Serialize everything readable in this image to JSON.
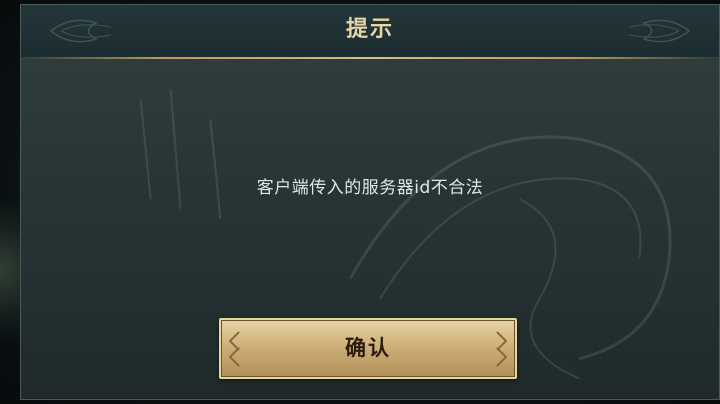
{
  "dialog": {
    "title": "提示",
    "message": "客户端传入的服务器id不合法",
    "confirm_label": "确认"
  },
  "icons": {
    "header_ornament": "leaf-ornament-icon",
    "button_chevron": "chevron-ornament-icon"
  },
  "colors": {
    "title_text": "#e6d5a6",
    "message_text": "#dfe6e4",
    "panel_bg": "#2a3736",
    "gold_accent": "#d8be82",
    "button_fill": "#cfb07a",
    "button_text": "#2b1d0e"
  }
}
